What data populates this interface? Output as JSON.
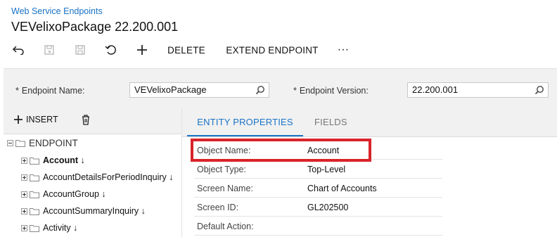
{
  "breadcrumb": "Web Service Endpoints",
  "page_title": "VEVelixoPackage 22.200.001",
  "toolbar": {
    "back_icon": "undo-arrow-icon",
    "save_close_icon": "save-close-icon",
    "save_icon": "save-icon",
    "cancel_icon": "revert-icon",
    "add_icon": "plus-icon",
    "delete_label": "DELETE",
    "extend_label": "EXTEND ENDPOINT",
    "more_label": "···"
  },
  "form": {
    "endpoint_name_label": "Endpoint Name:",
    "endpoint_name_value": "VEVelixoPackage",
    "endpoint_version_label": "Endpoint Version:",
    "endpoint_version_value": "22.200.001",
    "required_marker": "*"
  },
  "left": {
    "insert_label": "INSERT",
    "root_label": "ENDPOINT",
    "items": [
      {
        "label": "Account ↓"
      },
      {
        "label": "AccountDetailsForPeriodInquiry ↓"
      },
      {
        "label": "AccountGroup ↓"
      },
      {
        "label": "AccountSummaryInquiry ↓"
      },
      {
        "label": "Activity ↓"
      }
    ]
  },
  "tabs": [
    {
      "label": "ENTITY PROPERTIES"
    },
    {
      "label": "FIELDS"
    }
  ],
  "properties": [
    {
      "label": "Object Name:",
      "value": "Account"
    },
    {
      "label": "Object Type:",
      "value": "Top-Level"
    },
    {
      "label": "Screen Name:",
      "value": "Chart of Accounts"
    },
    {
      "label": "Screen ID:",
      "value": "GL202500"
    },
    {
      "label": "Default Action:",
      "value": ""
    }
  ],
  "colors": {
    "accent": "#1a73c6",
    "highlight": "#d9232a"
  }
}
